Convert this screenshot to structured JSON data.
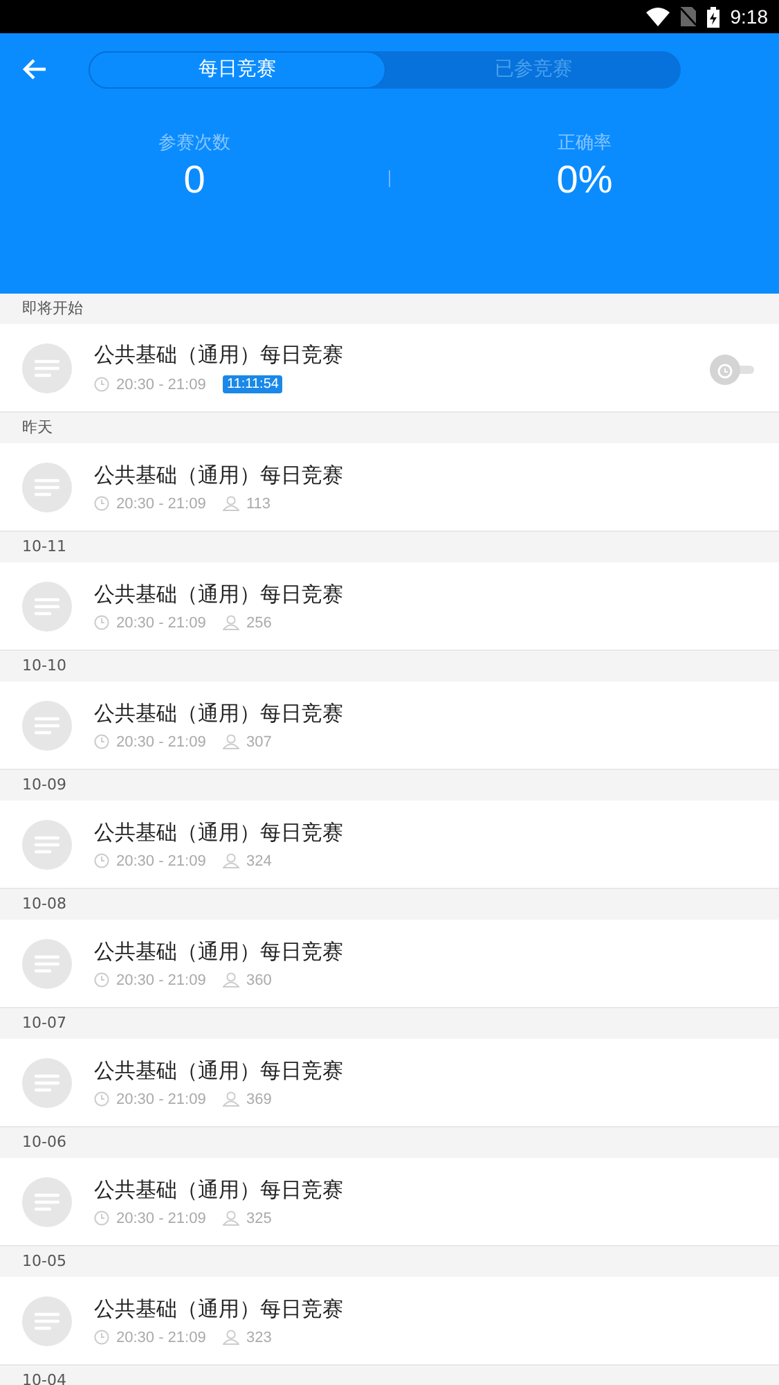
{
  "status_bar": {
    "time": "9:18"
  },
  "tabs": [
    {
      "label": "每日竞赛",
      "selected": true
    },
    {
      "label": "已参竞赛",
      "selected": false
    }
  ],
  "stats": [
    {
      "label": "参赛次数",
      "value": "0"
    },
    {
      "label": "正确率",
      "value": "0%"
    }
  ],
  "sections": [
    {
      "heading": "即将开始",
      "items": [
        {
          "kind": "upcoming",
          "title": "公共基础（通用）每日竞赛",
          "time": "20:30 - 21:09",
          "countdown": "11:11:54",
          "reminder_on": false
        }
      ]
    },
    {
      "heading": "昨天",
      "items": [
        {
          "kind": "finished",
          "title": "公共基础（通用）每日竞赛",
          "time": "20:30 - 21:09",
          "participants": "113"
        }
      ]
    },
    {
      "heading": "10-11",
      "items": [
        {
          "kind": "finished",
          "title": "公共基础（通用）每日竞赛",
          "time": "20:30 - 21:09",
          "participants": "256"
        }
      ]
    },
    {
      "heading": "10-10",
      "items": [
        {
          "kind": "finished",
          "title": "公共基础（通用）每日竞赛",
          "time": "20:30 - 21:09",
          "participants": "307"
        }
      ]
    },
    {
      "heading": "10-09",
      "items": [
        {
          "kind": "finished",
          "title": "公共基础（通用）每日竞赛",
          "time": "20:30 - 21:09",
          "participants": "324"
        }
      ]
    },
    {
      "heading": "10-08",
      "items": [
        {
          "kind": "finished",
          "title": "公共基础（通用）每日竞赛",
          "time": "20:30 - 21:09",
          "participants": "360"
        }
      ]
    },
    {
      "heading": "10-07",
      "items": [
        {
          "kind": "finished",
          "title": "公共基础（通用）每日竞赛",
          "time": "20:30 - 21:09",
          "participants": "369"
        }
      ]
    },
    {
      "heading": "10-06",
      "items": [
        {
          "kind": "finished",
          "title": "公共基础（通用）每日竞赛",
          "time": "20:30 - 21:09",
          "participants": "325"
        }
      ]
    },
    {
      "heading": "10-05",
      "items": [
        {
          "kind": "finished",
          "title": "公共基础（通用）每日竞赛",
          "time": "20:30 - 21:09",
          "participants": "323"
        }
      ]
    },
    {
      "heading": "10-04"
    }
  ]
}
